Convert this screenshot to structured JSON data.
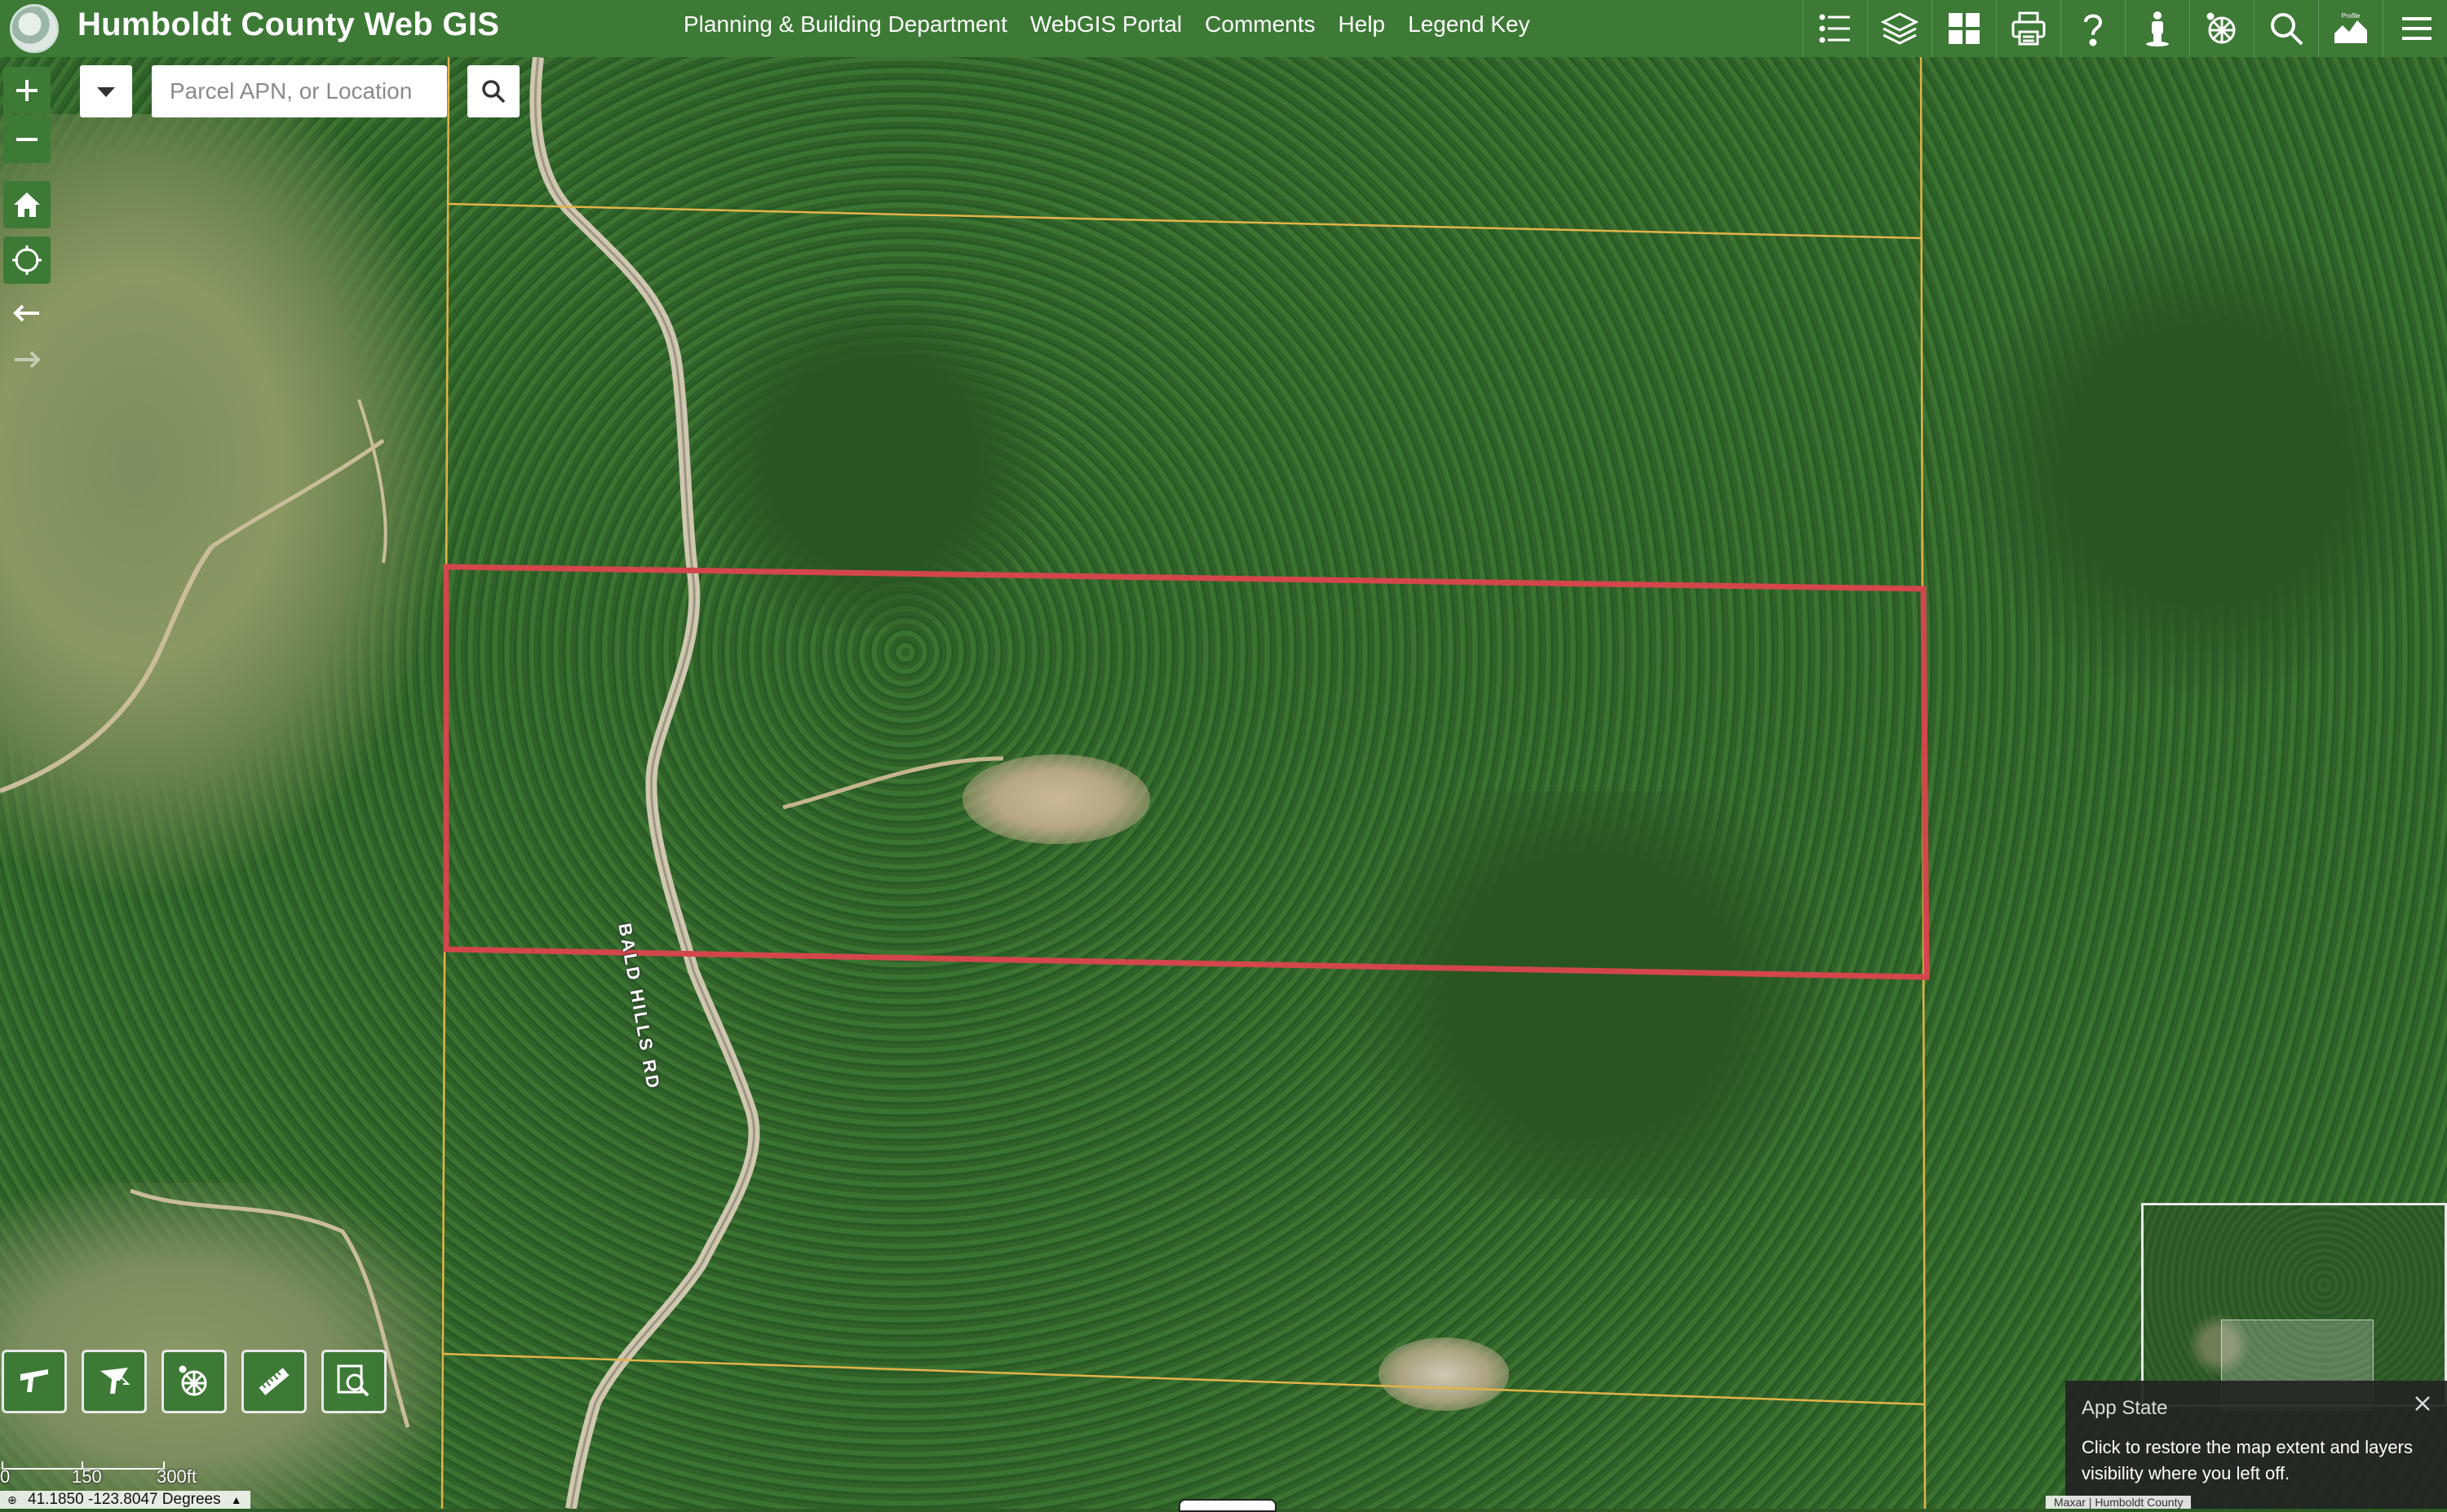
{
  "header": {
    "title": "Humboldt County Web GIS",
    "nav_links": [
      "Planning & Building Department",
      "WebGIS Portal",
      "Comments",
      "Help",
      "Legend Key"
    ],
    "widgets": [
      "layer-list-icon",
      "layers-icon",
      "basemap-gallery-icon",
      "print-icon",
      "help-icon",
      "street-view-icon",
      "analysis-icon",
      "search-icon",
      "elevation-profile-icon",
      "menu-icon"
    ],
    "profile_icon_caption": "Profile"
  },
  "search": {
    "placeholder": "Parcel APN, or Location"
  },
  "map_controls": {
    "zoom_in": "+",
    "zoom_out": "−",
    "tools": [
      "home-icon",
      "locate-icon",
      "previous-extent-icon",
      "next-extent-icon"
    ]
  },
  "map": {
    "road_label": "BALD HILLS RD",
    "selected_parcel_color": "#d2464c",
    "parcel_line_color": "#e3b34a"
  },
  "bottom_tools": [
    "draw-icon",
    "select-icon",
    "analysis-icon",
    "measure-icon",
    "zoom-to-icon"
  ],
  "scalebar": {
    "labels": [
      "0",
      "150",
      "300ft"
    ]
  },
  "coordinates": {
    "text": "41.1850 -123.8047 Degrees"
  },
  "app_state": {
    "title": "App State",
    "message": "Click to restore the map extent and layers visibility where you left off."
  },
  "attribution": {
    "text": "Maxar | Humboldt County"
  },
  "colors": {
    "header_bg": "#3d7a36",
    "panel_bg": "#242424"
  }
}
